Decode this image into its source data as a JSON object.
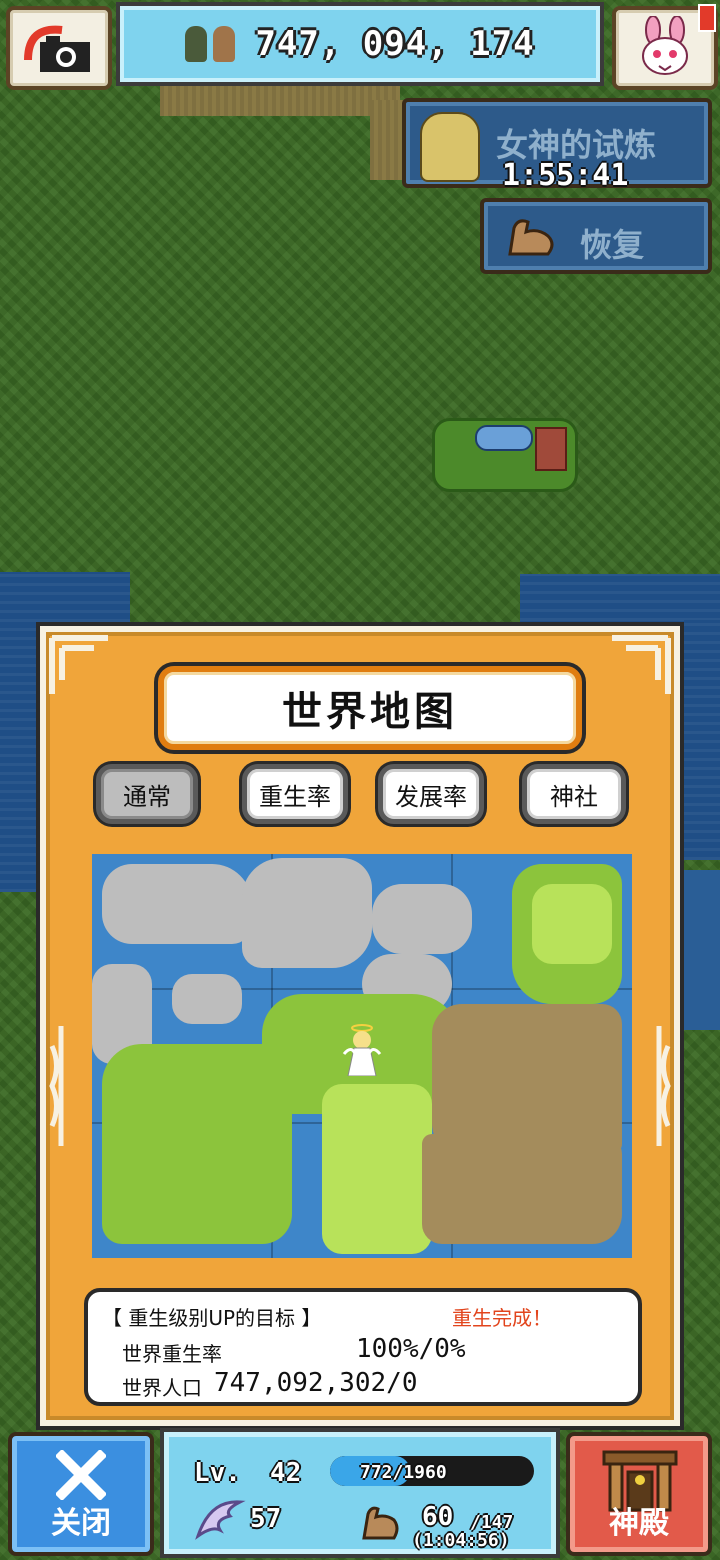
{
  "hud": {
    "population": "747, 094, 174",
    "icons": {
      "camera": "camera-icon",
      "rabbit": "rabbit-mascot-icon",
      "people": "villagers-icon"
    }
  },
  "trial": {
    "label": "女神的试炼",
    "timer": "1:55:41"
  },
  "recover": {
    "label": "恢复"
  },
  "world_map": {
    "title": "世界地图",
    "tabs": [
      "通常",
      "重生率",
      "发展率",
      "神社"
    ],
    "active_tab": "通常"
  },
  "goal": {
    "heading": "【 重生级别UP的目标 】",
    "status": "重生完成！",
    "rebirth_label": "世界重生率",
    "rebirth_value": "100%/0%",
    "population_label": "世界人口",
    "population_value": "747,092,302/0"
  },
  "bottom": {
    "close_label": "关闭",
    "temple_label": "神殿",
    "level_label": "Lv.",
    "level": "42",
    "exp_text": "772/1960",
    "exp_fraction": 0.394,
    "wings": "57",
    "power": "60",
    "power_max": "/147",
    "power_timer": "(1:04:56)"
  },
  "colors": {
    "panel": "#f0a53a",
    "hud": "#7fd3ee",
    "close": "#3b8fe0",
    "temple": "#e25a4a",
    "status_red": "#e2441c"
  }
}
